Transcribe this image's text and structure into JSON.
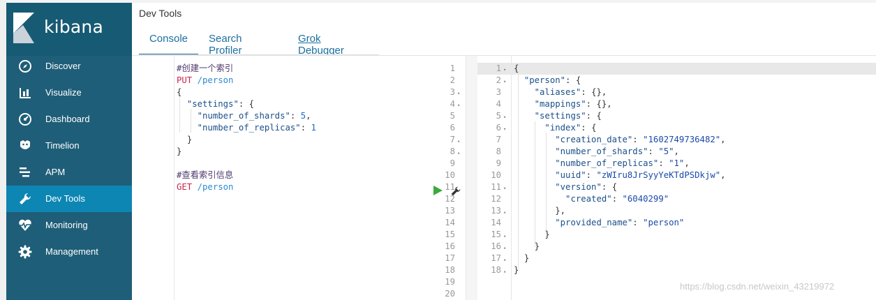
{
  "app": {
    "logo_text": "kibana",
    "section_title": "Dev Tools",
    "brand_colors": {
      "sidebar": "#1f5e78",
      "active": "#0d86b4",
      "link": "#1a6fa0"
    }
  },
  "sidebar": {
    "items": [
      {
        "label": "Discover",
        "icon": "compass-icon",
        "active": false
      },
      {
        "label": "Visualize",
        "icon": "bar-chart-icon",
        "active": false
      },
      {
        "label": "Dashboard",
        "icon": "gauge-icon",
        "active": false
      },
      {
        "label": "Timelion",
        "icon": "timelion-icon",
        "active": false
      },
      {
        "label": "APM",
        "icon": "apm-icon",
        "active": false
      },
      {
        "label": "Dev Tools",
        "icon": "wrench-icon",
        "active": true
      },
      {
        "label": "Monitoring",
        "icon": "heartbeat-icon",
        "active": false
      },
      {
        "label": "Management",
        "icon": "gear-icon",
        "active": false
      }
    ]
  },
  "tabs": [
    {
      "label": "Console",
      "active": true
    },
    {
      "label": "Search Profiler",
      "active": false
    },
    {
      "label": "Grok Debugger",
      "active": false
    }
  ],
  "console": {
    "lines": [
      {
        "n": "1",
        "fold": "",
        "text": "#创建一个索引"
      },
      {
        "n": "2",
        "fold": "",
        "text": "PUT /person"
      },
      {
        "n": "3",
        "fold": "▾",
        "text": "{"
      },
      {
        "n": "4",
        "fold": "▾",
        "text": "  \"settings\": {"
      },
      {
        "n": "5",
        "fold": "",
        "text": "    \"number_of_shards\": 5,"
      },
      {
        "n": "6",
        "fold": "",
        "text": "    \"number_of_replicas\": 1"
      },
      {
        "n": "7",
        "fold": "▴",
        "text": "  }"
      },
      {
        "n": "8",
        "fold": "▴",
        "text": "}"
      },
      {
        "n": "9",
        "fold": "",
        "text": ""
      },
      {
        "n": "10",
        "fold": "",
        "text": "#查看索引信息"
      },
      {
        "n": "11",
        "fold": "",
        "text": "GET /person"
      },
      {
        "n": "12",
        "fold": "",
        "text": ""
      },
      {
        "n": "13",
        "fold": "",
        "text": ""
      },
      {
        "n": "14",
        "fold": "",
        "text": ""
      },
      {
        "n": "15",
        "fold": "",
        "text": ""
      },
      {
        "n": "16",
        "fold": "",
        "text": ""
      },
      {
        "n": "17",
        "fold": "",
        "text": ""
      },
      {
        "n": "18",
        "fold": "",
        "text": ""
      },
      {
        "n": "19",
        "fold": "",
        "text": ""
      },
      {
        "n": "20",
        "fold": "",
        "text": ""
      }
    ]
  },
  "response": {
    "lines": [
      {
        "n": "1",
        "fold": "▾",
        "text": "{"
      },
      {
        "n": "2",
        "fold": "▾",
        "text": "  \"person\": {"
      },
      {
        "n": "3",
        "fold": "",
        "text": "    \"aliases\": {},"
      },
      {
        "n": "4",
        "fold": "",
        "text": "    \"mappings\": {},"
      },
      {
        "n": "5",
        "fold": "▾",
        "text": "    \"settings\": {"
      },
      {
        "n": "6",
        "fold": "▾",
        "text": "      \"index\": {"
      },
      {
        "n": "7",
        "fold": "",
        "text": "        \"creation_date\": \"1602749736482\","
      },
      {
        "n": "8",
        "fold": "",
        "text": "        \"number_of_shards\": \"5\","
      },
      {
        "n": "9",
        "fold": "",
        "text": "        \"number_of_replicas\": \"1\","
      },
      {
        "n": "10",
        "fold": "",
        "text": "        \"uuid\": \"zWIru8JrSyyYeKTdPSDkjw\","
      },
      {
        "n": "11",
        "fold": "▾",
        "text": "        \"version\": {"
      },
      {
        "n": "12",
        "fold": "",
        "text": "          \"created\": \"6040299\""
      },
      {
        "n": "13",
        "fold": "▴",
        "text": "        },"
      },
      {
        "n": "14",
        "fold": "",
        "text": "        \"provided_name\": \"person\""
      },
      {
        "n": "15",
        "fold": "▴",
        "text": "      }"
      },
      {
        "n": "16",
        "fold": "▴",
        "text": "    }"
      },
      {
        "n": "17",
        "fold": "▴",
        "text": "  }"
      },
      {
        "n": "18",
        "fold": "▴",
        "text": "}"
      }
    ]
  },
  "watermark": "https://blog.csdn.net/weixin_43219972"
}
